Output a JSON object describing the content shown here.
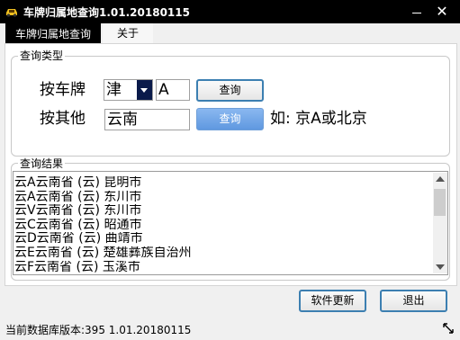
{
  "window": {
    "title": "车牌归属地查询1.01.20180115",
    "close_glyph": "✕"
  },
  "tabs": [
    {
      "label": "车牌归属地查询",
      "active": true
    },
    {
      "label": "关于",
      "active": false
    }
  ],
  "query_type": {
    "legend": "查询类型",
    "by_plate_label": "按车牌",
    "province_value": "津",
    "letter_value": "A",
    "query_button_1": "查询",
    "by_other_label": "按其他",
    "other_value": "云南",
    "query_button_2": "查询",
    "example_text": "如: 京A或北京"
  },
  "results": {
    "legend": "查询结果",
    "items": [
      "云A云南省 (云) 昆明市",
      "云A云南省 (云) 东川市",
      "云V云南省 (云) 东川市",
      "云C云南省 (云) 昭通市",
      "云D云南省 (云) 曲靖市",
      "云E云南省 (云) 楚雄彝族自治州",
      "云F云南省 (云) 玉溪市"
    ]
  },
  "buttons": {
    "update": "软件更新",
    "exit": "退出"
  },
  "status_bar": {
    "text": "当前数据库版本:395 1.01.20180115"
  },
  "icons": {
    "app": "car-icon",
    "combo_arrow": "chevron-down-icon",
    "resize_grip": "resize-grip-icon"
  },
  "colors": {
    "titlebar": "#000000",
    "active_button_border": "#3c7fb1",
    "highlight_button": "#6fa6e8"
  }
}
